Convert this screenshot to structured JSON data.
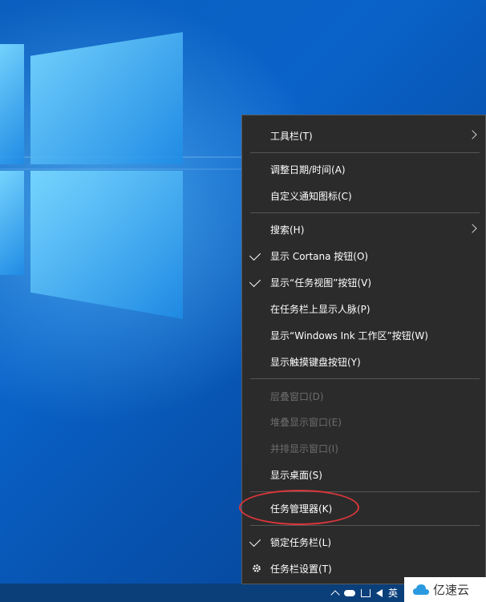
{
  "menu": {
    "items": [
      {
        "label": "工具栏(T)",
        "checked": false,
        "submenu": true,
        "disabled": false
      },
      {
        "label": "调整日期/时间(A)",
        "checked": false,
        "submenu": false,
        "disabled": false
      },
      {
        "label": "自定义通知图标(C)",
        "checked": false,
        "submenu": false,
        "disabled": false
      },
      {
        "label": "搜索(H)",
        "checked": false,
        "submenu": true,
        "disabled": false
      },
      {
        "label": "显示 Cortana 按钮(O)",
        "checked": true,
        "submenu": false,
        "disabled": false
      },
      {
        "label": "显示“任务视图”按钮(V)",
        "checked": true,
        "submenu": false,
        "disabled": false
      },
      {
        "label": "在任务栏上显示人脉(P)",
        "checked": false,
        "submenu": false,
        "disabled": false
      },
      {
        "label": "显示“Windows Ink 工作区”按钮(W)",
        "checked": false,
        "submenu": false,
        "disabled": false
      },
      {
        "label": "显示触摸键盘按钮(Y)",
        "checked": false,
        "submenu": false,
        "disabled": false
      },
      {
        "label": "层叠窗口(D)",
        "checked": false,
        "submenu": false,
        "disabled": true
      },
      {
        "label": "堆叠显示窗口(E)",
        "checked": false,
        "submenu": false,
        "disabled": true
      },
      {
        "label": "并排显示窗口(I)",
        "checked": false,
        "submenu": false,
        "disabled": true
      },
      {
        "label": "显示桌面(S)",
        "checked": false,
        "submenu": false,
        "disabled": false
      },
      {
        "label": "任务管理器(K)",
        "checked": false,
        "submenu": false,
        "disabled": false
      },
      {
        "label": "锁定任务栏(L)",
        "checked": true,
        "submenu": false,
        "disabled": false
      },
      {
        "label": "任务栏设置(T)",
        "checked": false,
        "submenu": false,
        "disabled": false,
        "icon": "gear-icon"
      }
    ]
  },
  "taskbar": {
    "ime_label": "英"
  },
  "watermark": {
    "text": "亿速云",
    "icon": "cloud-logo-icon"
  },
  "colors": {
    "menu_bg": "#2b2b2b",
    "menu_text": "#ffffff",
    "disabled_text": "#6d6d6d",
    "highlight_ring": "#d9363a",
    "desktop_blue": "#0a63c9"
  }
}
